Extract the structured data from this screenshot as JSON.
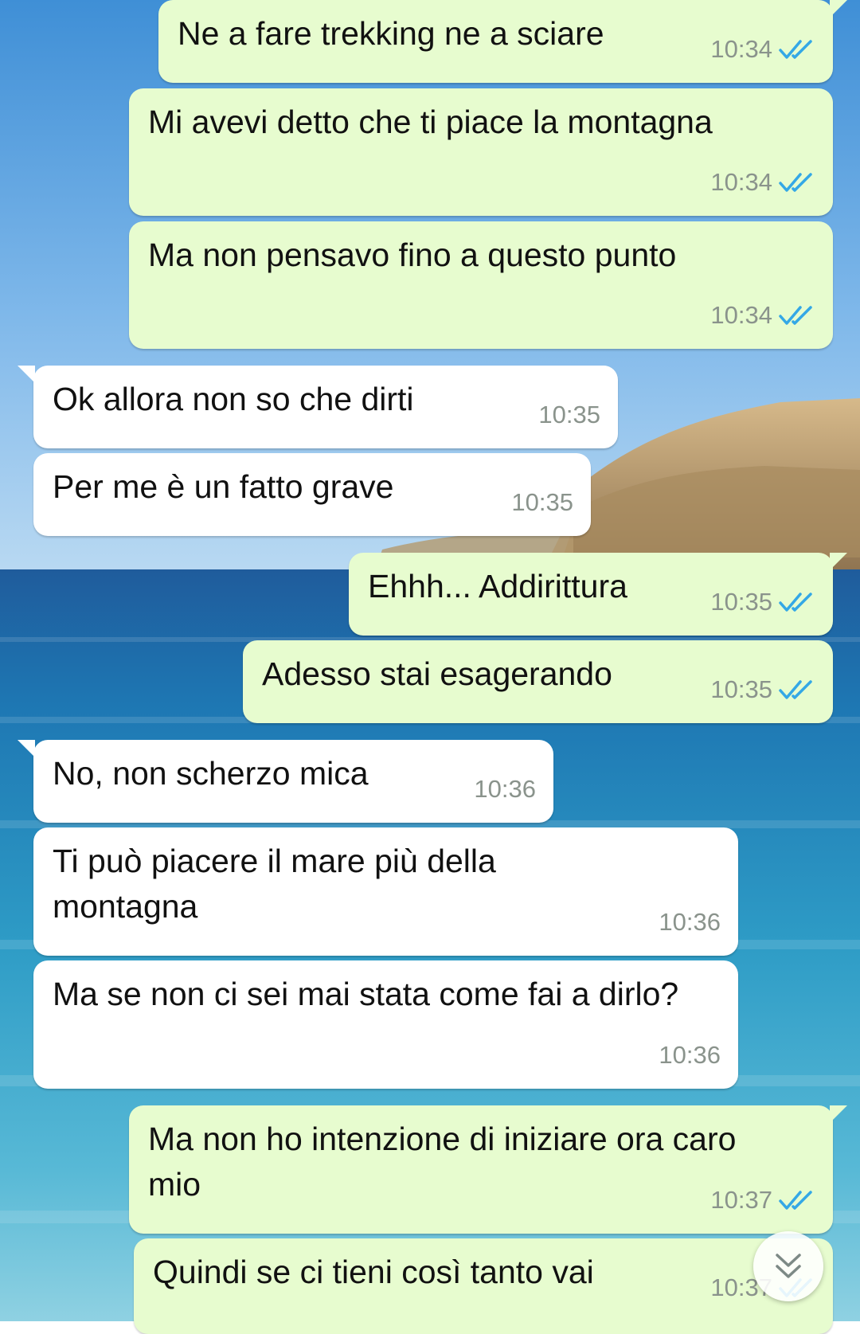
{
  "theme": {
    "outgoing_bubble": "#e7fccf",
    "incoming_bubble": "#ffffff",
    "read_ticks": "#34a8e6",
    "timestamp": "#8a938c"
  },
  "messages": [
    {
      "id": "m1",
      "direction": "out",
      "text": "Ne a fare trekking ne a sciare",
      "time": "10:34",
      "status": "read"
    },
    {
      "id": "m2",
      "direction": "out",
      "text": "Mi avevi detto che ti piace la montagna",
      "time": "10:34",
      "status": "read"
    },
    {
      "id": "m3",
      "direction": "out",
      "text": "Ma non pensavo fino a questo punto",
      "time": "10:34",
      "status": "read"
    },
    {
      "id": "m4",
      "direction": "in",
      "text": "Ok allora non so che dirti",
      "time": "10:35"
    },
    {
      "id": "m5",
      "direction": "in",
      "text": "Per me è un fatto grave",
      "time": "10:35"
    },
    {
      "id": "m6",
      "direction": "out",
      "text": "Ehhh... Addirittura",
      "time": "10:35",
      "status": "read"
    },
    {
      "id": "m7",
      "direction": "out",
      "text": "Adesso stai esagerando",
      "time": "10:35",
      "status": "read"
    },
    {
      "id": "m8",
      "direction": "in",
      "text": "No, non scherzo mica",
      "time": "10:36"
    },
    {
      "id": "m9",
      "direction": "in",
      "text": "Ti può piacere il mare più della montagna",
      "time": "10:36"
    },
    {
      "id": "m10",
      "direction": "in",
      "text": "Ma se non ci sei mai stata come fai a dirlo?",
      "time": "10:36"
    },
    {
      "id": "m11",
      "direction": "out",
      "text": "Ma non ho intenzione di iniziare ora caro mio",
      "time": "10:37",
      "status": "read"
    },
    {
      "id": "m12",
      "direction": "out",
      "text": "Quindi se ci tieni così tanto vai",
      "time": "10:37",
      "status": "read"
    }
  ],
  "scroll_button": {
    "icon": "double-chevron-down-icon"
  },
  "wallpaper": {
    "subject": "sea-with-rocky-island-photo"
  }
}
